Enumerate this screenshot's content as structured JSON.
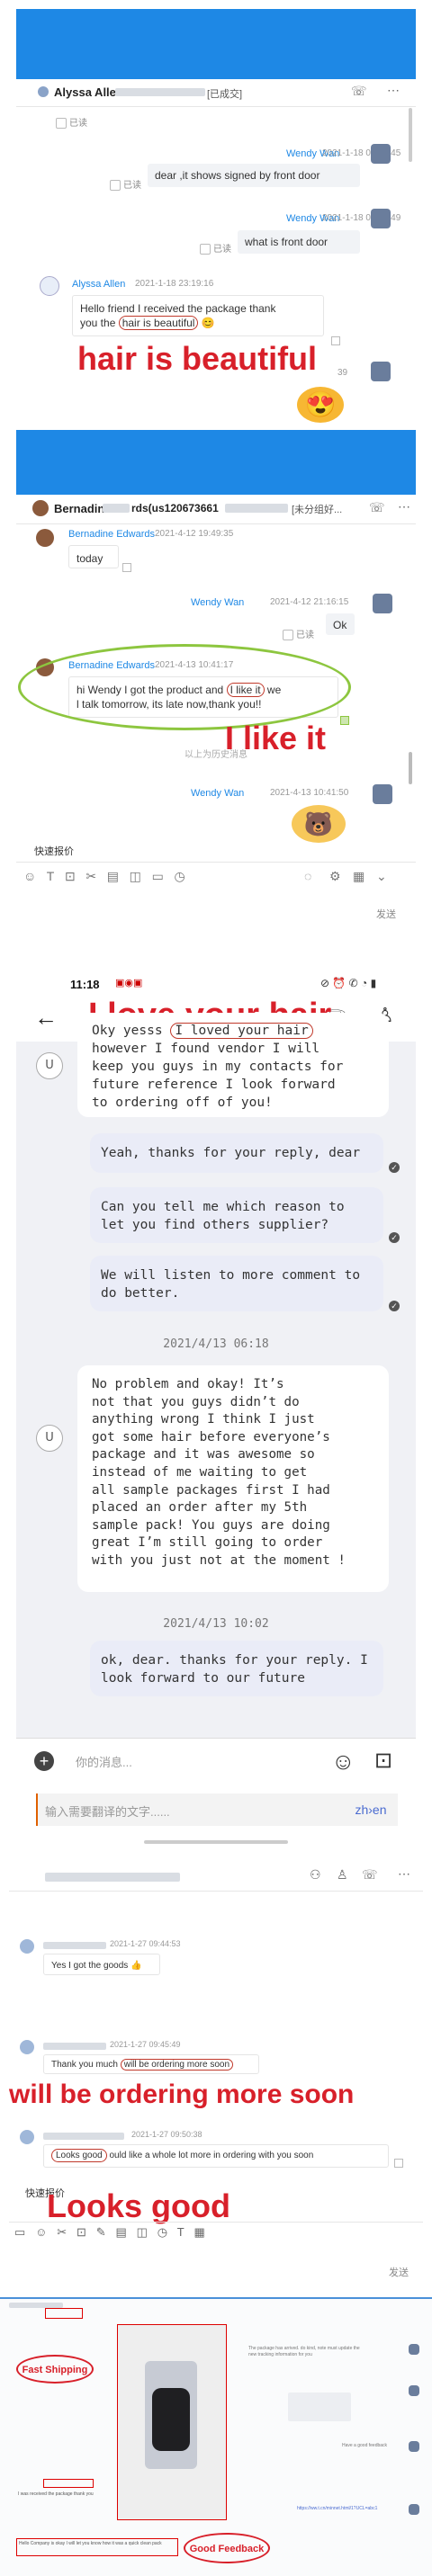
{
  "p1": {
    "contact": "Alyssa Allen",
    "contact_suffix": "[已成交]",
    "read": "已读",
    "m1_sender": "Wendy Wan",
    "m1_time": "2021-1-18 09:59:45",
    "m1_text": "dear ,it shows signed by front door",
    "m2_sender": "Wendy Wan",
    "m2_time": "2021-1-18 09:59:49",
    "m2_text": "what is front door",
    "m3_sender": "Alyssa Allen",
    "m3_time": "2021-1-18 23:19:16",
    "m3_line1": "Hello friend I received the package thank",
    "m3_line2a": "you the ",
    "m3_line2b": "hair is beautiful",
    "m3_line2c": " 😊",
    "m4_time": "39",
    "caption": "hair is beautiful"
  },
  "p2": {
    "contact": "Bernadin",
    "contact_mid": "rds(us120673661",
    "contact_suffix": "[未分组好...",
    "m1_sender": "Bernadine Edwards",
    "m1_time": "2021-4-12 19:49:35",
    "m1_text": "today",
    "m2_sender": "Wendy Wan",
    "m2_time": "2021-4-12 21:16:15",
    "m2_text": "Ok",
    "read": "已读",
    "m3_sender": "Bernadine Edwards",
    "m3_time": "2021-4-13 10:41:17",
    "m3_line1a": "hi Wendy I got the product and ",
    "m3_line1b": "I like it",
    "m3_line1c": " we",
    "m3_line2": "l talk tomorrow, its late now,thank you!!",
    "history": "以上为历史消息",
    "m4_sender": "Wendy Wan",
    "m4_time": "2021-4-13 10:41:50",
    "quick_quote": "快速报价",
    "send": "发送",
    "caption": "I like it"
  },
  "p3": {
    "clock": "11:18",
    "title_caption": "I love your hair",
    "c1_pre": "Oky yesss",
    "c1_circle": "I loved your hair",
    "c1_rest": "however I found vendor I will\nkeep you guys in my contacts for\nfuture reference I look forward\nto ordering off of you!",
    "u_label": "U",
    "r1": "Yeah, thanks for your reply, dear",
    "r2": "Can you tell me which reason to\nlet you find others supplier?",
    "r3": "We will listen to more comment to\ndo better.",
    "date1": "2021/4/13 06:18",
    "c2": "No problem and okay! It’s\nnot that you guys didn’t do\nanything wrong I think I just\ngot some hair before everyone’s\npackage and it was awesome so\ninstead of me waiting to get\nall sample packages first I had\nplaced an order after my 5th\nsample pack! You guys are doing\ngreat I’m still going to order\nwith you just not at the moment !",
    "date2": "2021/4/13 10:02",
    "r4": "ok, dear. thanks for your reply. I\nlook forward to our future",
    "input_placeholder": "你的消息...",
    "translate_placeholder": "输入需要翻译的文字......",
    "translate_dir": "zh›en"
  },
  "p4": {
    "m1_time": "2021-1-27 09:44:53",
    "m1_text": "Yes I got the goods 👍",
    "m2_time": "2021-1-27 09:45:49",
    "m2_pre": "Thank you much ",
    "m2_circle": "will be ordering more soon",
    "m3_time": "2021-1-27 09:50:38",
    "m3_circle": "Looks good",
    "m3_rest": " ould like a whole lot more in ordering with you soon",
    "caption1": "will be ordering more soon",
    "quick_quote": "快速报价",
    "caption2": "Looks good",
    "send": "发送"
  },
  "p5": {
    "label1": "Fast Shipping",
    "label2": "Good Feedback",
    "small1": "The package has arrived. do kind, note must update the new tracking information for you",
    "small2": "Have a good feedback",
    "small3": "I was received the package thank you",
    "small4": "https://ww.t.cn/minnet.html/1?UCL=abc1",
    "small5": "Hello Company is okay I will let you know how it was a quick clean pack"
  }
}
